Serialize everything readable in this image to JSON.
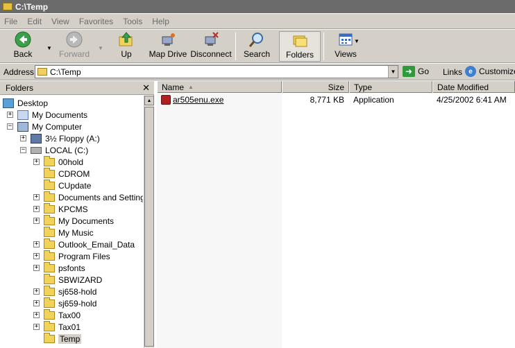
{
  "window": {
    "title": "C:\\Temp"
  },
  "menu": [
    "File",
    "Edit",
    "View",
    "Favorites",
    "Tools",
    "Help"
  ],
  "toolbar": {
    "back": "Back",
    "forward": "Forward",
    "up": "Up",
    "map_drive": "Map Drive",
    "disconnect": "Disconnect",
    "search": "Search",
    "folders": "Folders",
    "views": "Views"
  },
  "address": {
    "label": "Address",
    "value": "C:\\Temp",
    "go": "Go",
    "links": "Links",
    "customize": "Customize"
  },
  "folders_pane": {
    "title": "Folders",
    "close": "✕",
    "tree": [
      {
        "label": "Desktop",
        "icon": "desktop-icon",
        "level": 0,
        "expander": ""
      },
      {
        "label": "My Documents",
        "icon": "documents-icon",
        "level": 1,
        "expander": "+"
      },
      {
        "label": "My Computer",
        "icon": "computer-icon",
        "level": 1,
        "expander": "−"
      },
      {
        "label": "3½ Floppy (A:)",
        "icon": "floppy-icon",
        "level": 2,
        "expander": "+"
      },
      {
        "label": "LOCAL (C:)",
        "icon": "drive-icon",
        "level": 2,
        "expander": "−"
      },
      {
        "label": "00hold",
        "icon": "folder-icon",
        "level": 3,
        "expander": "+"
      },
      {
        "label": "CDROM",
        "icon": "folder-icon",
        "level": 3,
        "expander": ""
      },
      {
        "label": "CUpdate",
        "icon": "folder-icon",
        "level": 3,
        "expander": ""
      },
      {
        "label": "Documents and Settings",
        "icon": "folder-icon",
        "level": 3,
        "expander": "+"
      },
      {
        "label": "KPCMS",
        "icon": "folder-icon",
        "level": 3,
        "expander": "+"
      },
      {
        "label": "My Documents",
        "icon": "folder-icon",
        "level": 3,
        "expander": "+"
      },
      {
        "label": "My Music",
        "icon": "folder-icon",
        "level": 3,
        "expander": ""
      },
      {
        "label": "Outlook_Email_Data",
        "icon": "folder-icon",
        "level": 3,
        "expander": "+"
      },
      {
        "label": "Program Files",
        "icon": "folder-icon",
        "level": 3,
        "expander": "+"
      },
      {
        "label": "psfonts",
        "icon": "folder-icon",
        "level": 3,
        "expander": "+"
      },
      {
        "label": "SBWIZARD",
        "icon": "folder-icon",
        "level": 3,
        "expander": ""
      },
      {
        "label": "sj658-hold",
        "icon": "folder-icon",
        "level": 3,
        "expander": "+"
      },
      {
        "label": "sj659-hold",
        "icon": "folder-icon",
        "level": 3,
        "expander": "+"
      },
      {
        "label": "Tax00",
        "icon": "folder-icon",
        "level": 3,
        "expander": "+"
      },
      {
        "label": "Tax01",
        "icon": "folder-icon",
        "level": 3,
        "expander": "+"
      },
      {
        "label": "Temp",
        "icon": "folder-open-icon",
        "level": 3,
        "expander": "",
        "selected": true
      }
    ]
  },
  "file_list": {
    "columns": {
      "name": "Name",
      "size": "Size",
      "type": "Type",
      "date": "Date Modified"
    },
    "rows": [
      {
        "name": "ar505enu.exe",
        "size": "8,771 KB",
        "type": "Application",
        "date": "4/25/2002 6:41 AM"
      }
    ]
  }
}
